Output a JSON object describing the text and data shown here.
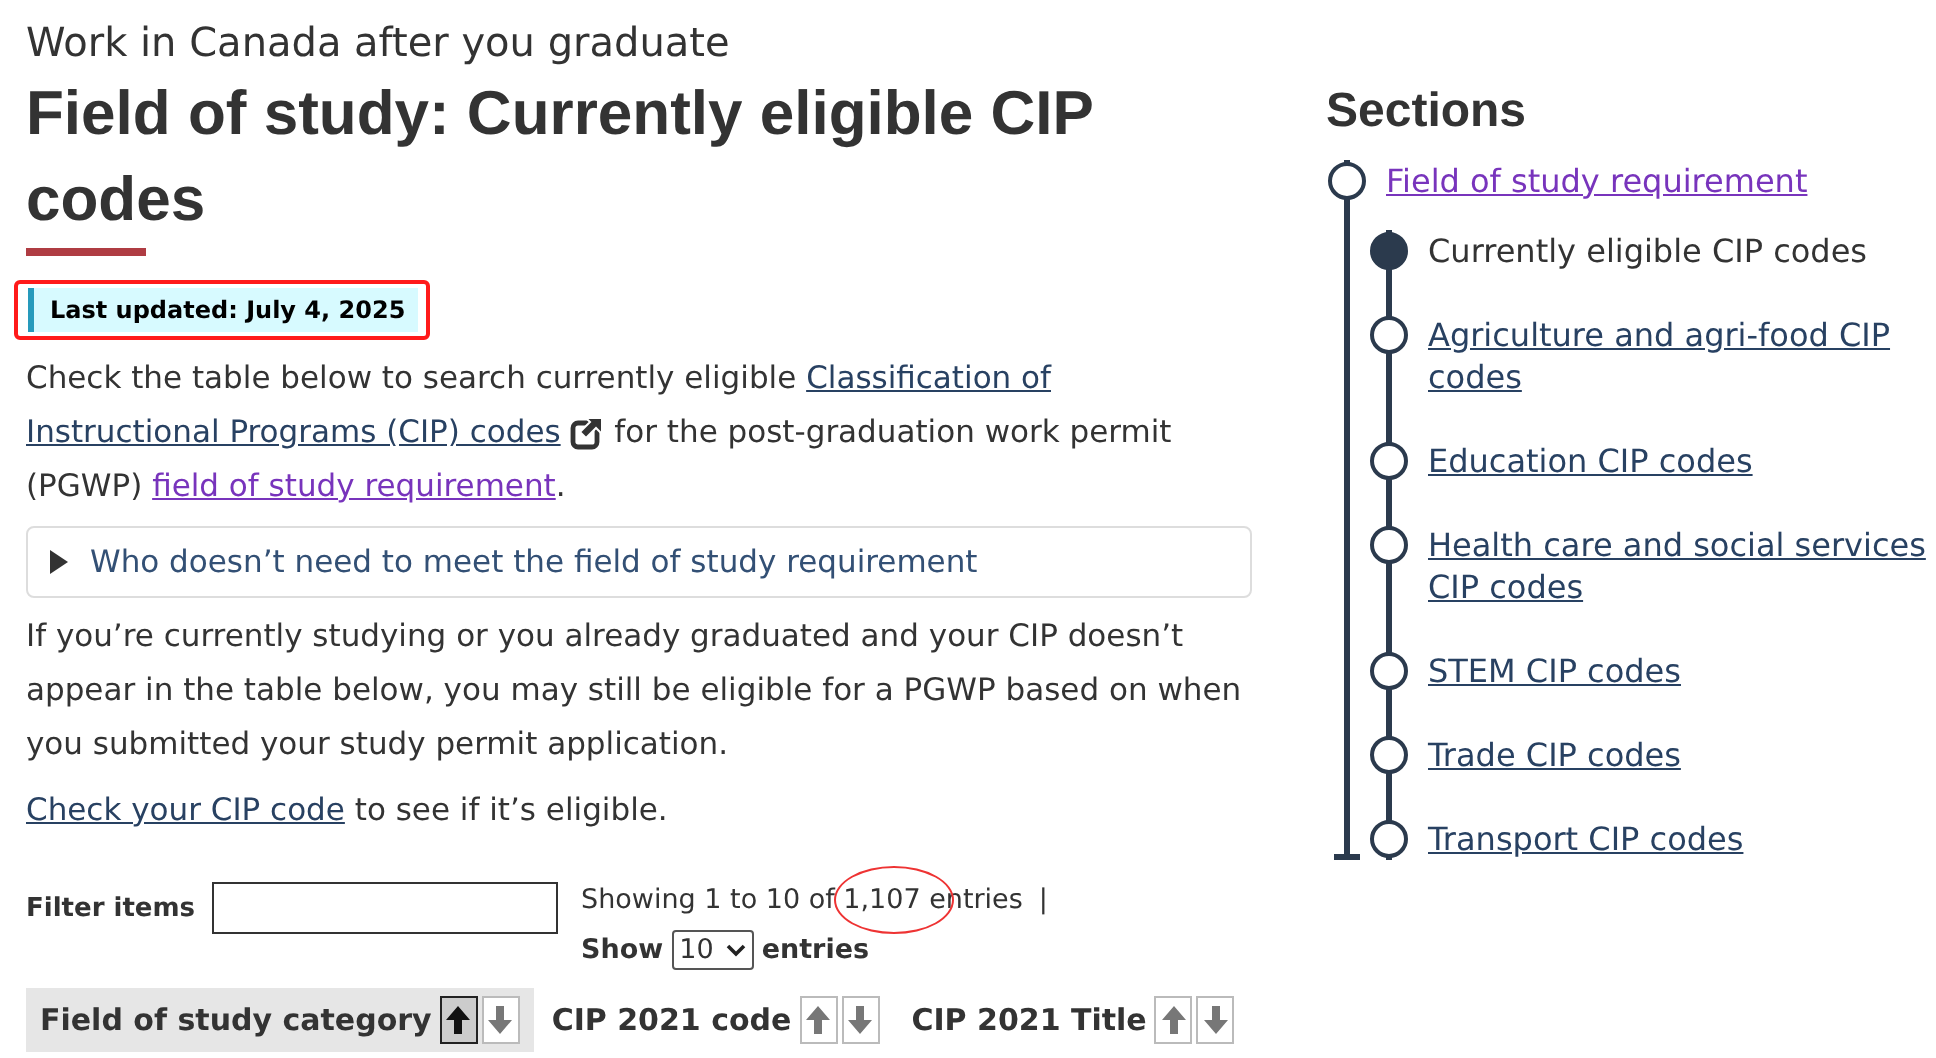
{
  "breadcrumb_heading": "Work in Canada after you graduate",
  "title": "Field of study: Currently eligible CIP codes",
  "last_updated": "Last updated: July 4, 2025",
  "intro": [
    {
      "kind": "text",
      "text": "Check the table below to search currently eligible "
    },
    {
      "kind": "link",
      "text": "Classification of",
      "visited": false
    },
    {
      "kind": "external_link",
      "text": "Instructional Programs (CIP) codes",
      "visited": false
    },
    {
      "kind": "text",
      "text": " for the post-graduation work permit (PGWP) "
    },
    {
      "kind": "link",
      "text": "field of study requirement",
      "visited": true
    },
    {
      "kind": "text",
      "text": "."
    }
  ],
  "details": {
    "summary": "Who doesn’t need to meet the field of study requirement",
    "expanded": false
  },
  "paragraph": "If you’re currently studying or you already graduated and your CIP doesn’t appear in the table below, you may still be eligible for a PGWP based on when you submitted your study permit application.",
  "check_line": [
    {
      "kind": "link",
      "text": "Check your CIP code",
      "visited": false
    },
    {
      "kind": "text",
      "text": " to see if it’s eligible."
    }
  ],
  "filter": {
    "label": "Filter items"
  },
  "info": {
    "showing": "Showing 1 to 10 of 1,107 entries",
    "separator": "|",
    "show_label": "Show",
    "page_size": "10",
    "entries_label": "entries"
  },
  "table": {
    "columns": [
      {
        "label": "Field of study category",
        "sorted_ascending": true
      },
      {
        "label": "CIP 2021 code",
        "sorted_ascending": false
      },
      {
        "label": "CIP 2021 Title",
        "sorted_ascending": false
      }
    ]
  },
  "sections": {
    "title": "Sections",
    "items": [
      {
        "label": "Field of study requirement",
        "selected": false,
        "visited": true,
        "children": [
          {
            "label": "Currently eligible CIP codes",
            "selected": true
          },
          {
            "label": "Agriculture and agri-food CIP codes",
            "selected": false
          },
          {
            "label": "Education CIP codes",
            "selected": false
          },
          {
            "label": "Health care and social services CIP codes",
            "selected": false
          },
          {
            "label": "STEM CIP codes",
            "selected": false
          },
          {
            "label": "Trade CIP codes",
            "selected": false
          },
          {
            "label": "Transport CIP codes",
            "selected": false
          }
        ]
      }
    ]
  }
}
